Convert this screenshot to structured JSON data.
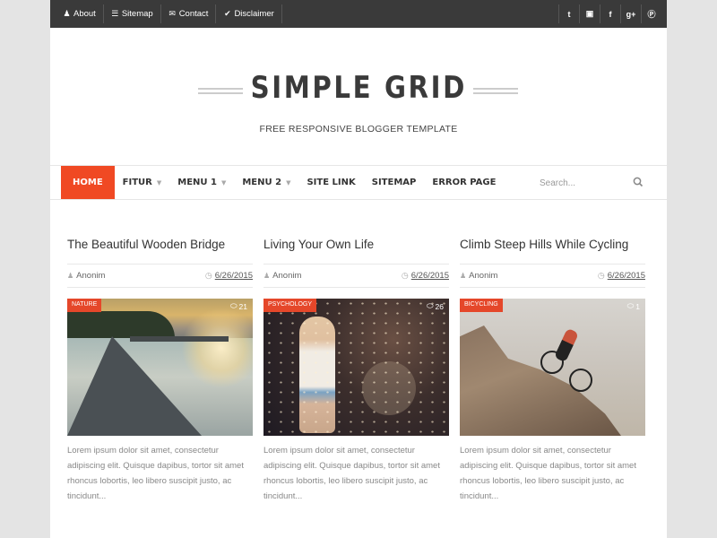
{
  "topbar": {
    "links": [
      {
        "icon": "user-icon",
        "glyph": "♟",
        "label": "About"
      },
      {
        "icon": "list-icon",
        "glyph": "☰",
        "label": "Sitemap"
      },
      {
        "icon": "envelope-icon",
        "glyph": "✉",
        "label": "Contact"
      },
      {
        "icon": "check-circle-icon",
        "glyph": "✔",
        "label": "Disclaimer"
      }
    ],
    "social": [
      {
        "icon": "twitter-icon",
        "glyph": "t"
      },
      {
        "icon": "instagram-icon",
        "glyph": "▣"
      },
      {
        "icon": "facebook-icon",
        "glyph": "f"
      },
      {
        "icon": "google-plus-icon",
        "glyph": "g+"
      },
      {
        "icon": "pinterest-icon",
        "glyph": "Ⓟ"
      }
    ]
  },
  "header": {
    "title": "SIMPLE GRID",
    "tagline": "FREE RESPONSIVE BLOGGER TEMPLATE"
  },
  "nav": {
    "items": [
      {
        "label": "HOME",
        "active": true,
        "dropdown": false
      },
      {
        "label": "FITUR",
        "active": false,
        "dropdown": true
      },
      {
        "label": "MENU 1",
        "active": false,
        "dropdown": true
      },
      {
        "label": "MENU 2",
        "active": false,
        "dropdown": true
      },
      {
        "label": "SITE LINK",
        "active": false,
        "dropdown": false
      },
      {
        "label": "SITEMAP",
        "active": false,
        "dropdown": false
      },
      {
        "label": "ERROR PAGE",
        "active": false,
        "dropdown": false
      }
    ],
    "caret": "▼",
    "search_placeholder": "Search..."
  },
  "posts": [
    {
      "title": "The Beautiful Wooden Bridge",
      "author": "Anonim",
      "date": "6/26/2015",
      "label": "NATURE",
      "comments": "21",
      "excerpt": "Lorem ipsum dolor sit amet, consectetur adipiscing elit. Quisque dapibus, tortor sit amet rhoncus lobortis, leo libero suscipit justo, ac tincidunt..."
    },
    {
      "title": "Living Your Own Life",
      "author": "Anonim",
      "date": "6/26/2015",
      "label": "PSYCHOLOGY",
      "comments": "26",
      "excerpt": "Lorem ipsum dolor sit amet, consectetur adipiscing elit. Quisque dapibus, tortor sit amet rhoncus lobortis, leo libero suscipit justo, ac tincidunt..."
    },
    {
      "title": "Climb Steep Hills While Cycling",
      "author": "Anonim",
      "date": "6/26/2015",
      "label": "BICYCLING",
      "comments": "1",
      "excerpt": "Lorem ipsum dolor sit amet, consectetur adipiscing elit. Quisque dapibus, tortor sit amet rhoncus lobortis, leo libero suscipit justo, ac tincidunt..."
    }
  ],
  "icons": {
    "author": "♟",
    "clock": "◷",
    "comment": "⬭"
  },
  "colors": {
    "accent": "#f04923",
    "topbar": "#3a3a3a",
    "label": "#e5472a"
  }
}
